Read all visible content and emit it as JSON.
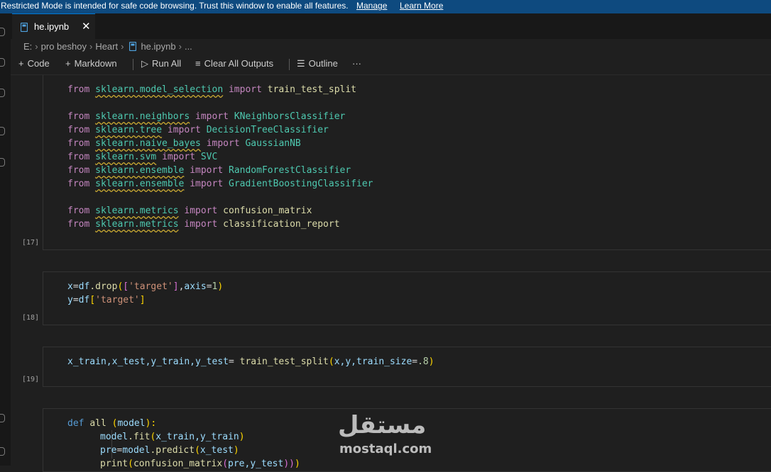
{
  "banner": {
    "message": "Restricted Mode is intended for safe code browsing. Trust this window to enable all features.",
    "manage": "Manage",
    "learn_more": "Learn More"
  },
  "tab": {
    "title": "he.ipynb",
    "close": "✕"
  },
  "breadcrumb": {
    "drive": "E:",
    "folder1": "pro beshoy",
    "folder2": "Heart",
    "file": "he.ipynb",
    "more": "..."
  },
  "toolbar": {
    "code": "Code",
    "markdown": "Markdown",
    "run_all": "Run All",
    "clear_outputs": "Clear All Outputs",
    "outline": "Outline",
    "more": "···"
  },
  "cells": {
    "c17": {
      "exec": "[17]",
      "l1": {
        "from": "from",
        "mod": "sklearn.model_selection",
        "imp": "import",
        "name": "train_test_split"
      },
      "l2": {
        "from": "from",
        "mod": "sklearn.neighbors",
        "imp": "import",
        "name": "KNeighborsClassifier"
      },
      "l3": {
        "from": "from",
        "mod": "sklearn.tree",
        "imp": "import",
        "name": "DecisionTreeClassifier"
      },
      "l4": {
        "from": "from",
        "mod": "sklearn.naive_bayes",
        "imp": "import",
        "name": "GaussianNB"
      },
      "l5": {
        "from": "from",
        "mod": "sklearn.svm",
        "imp": "import",
        "name": "SVC"
      },
      "l6": {
        "from": "from",
        "mod": "sklearn.ensemble",
        "imp": "import",
        "name": "RandomForestClassifier"
      },
      "l7": {
        "from": "from",
        "mod": "sklearn.ensemble",
        "imp": "import",
        "name": "GradientBoostingClassifier"
      },
      "l8": {
        "from": "from",
        "mod": "sklearn.metrics",
        "imp": "import",
        "name": "confusion_matrix"
      },
      "l9": {
        "from": "from",
        "mod": "sklearn.metrics",
        "imp": "import",
        "name": "classification_report"
      }
    },
    "c18": {
      "exec": "[18]",
      "l1": {
        "x": "x",
        "eq": "=",
        "df": "df",
        "drop": ".drop",
        "p1": "(",
        "b1": "[",
        "s": "'target'",
        "b2": "]",
        "comma": ",",
        "axis": "axis",
        "eq2": "=",
        "one": "1",
        "p2": ")"
      },
      "l2": {
        "y": "y",
        "eq": "=",
        "df": "df",
        "b1": "[",
        "s": "'target'",
        "b2": "]"
      }
    },
    "c19": {
      "exec": "[19]",
      "vars": "x_train,x_test,y_train,y_test",
      "eq": "= ",
      "fn": "train_test_split",
      "p1": "(",
      "args": "x,y,train_size",
      "eq2": "=",
      "num": ".8",
      "p2": ")"
    },
    "c20": {
      "def": "def",
      "fname": "all",
      "sig_open": " (",
      "param": "model",
      "sig_close": "):",
      "l2": {
        "model": "model",
        "fit": ".fit",
        "p1": "(",
        "args": "x_train,y_train",
        "p2": ")"
      },
      "l3": {
        "pre": "pre",
        "eq": "=",
        "model": "model",
        "predict": ".predict",
        "p1": "(",
        "arg": "x_test",
        "p2": ")"
      },
      "l4": {
        "print": "print",
        "p1": "(",
        "fn": "confusion_matrix",
        "p2": "(",
        "args": "pre,y_test",
        "p3": "))",
        "p4": ")"
      }
    }
  },
  "watermark": {
    "arabic": "مستقل",
    "latin": "mostaql.com"
  }
}
